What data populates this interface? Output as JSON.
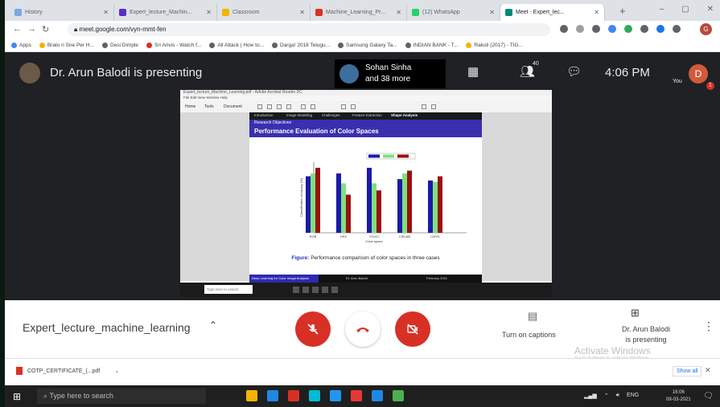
{
  "browser": {
    "tabs": [
      {
        "label": "History",
        "color": "#7aa7e6",
        "active": false
      },
      {
        "label": "Expert_lecture_Machin...",
        "color": "#5b2ec4",
        "active": false
      },
      {
        "label": "Classroom",
        "color": "#f4b400",
        "active": false
      },
      {
        "label": "Machine_Learning_Pr...",
        "color": "#d93025",
        "active": false
      },
      {
        "label": "(12) WhatsApp",
        "color": "#25d366",
        "active": false
      },
      {
        "label": "Meet - Expert_lec...",
        "color": "#00897b",
        "active": true
      }
    ],
    "url": "meet.google.com/vyn-mmt-fen",
    "bookmarks": [
      {
        "label": "Apps",
        "color": "#4285f4"
      },
      {
        "label": "Brato ri Sne Per H...",
        "color": "#f4b400"
      },
      {
        "label": "Desi Dimple",
        "color": "#5f6368"
      },
      {
        "label": "Sri Arivis - Watch f...",
        "color": "#d93025"
      },
      {
        "label": "All Attack | How to...",
        "color": "#5f6368"
      },
      {
        "label": "Darga! 2018 Telugu...",
        "color": "#5f6368"
      },
      {
        "label": "Samsung Galaxy Ta...",
        "color": "#5f6368"
      },
      {
        "label": "INDIAN BANK - T...",
        "color": "#5f6368"
      },
      {
        "label": "Raksti (2017) - TIG...",
        "color": "#f4b400"
      }
    ],
    "profile_initial": "G"
  },
  "meet": {
    "presenting_text": "Dr. Arun Balodi is presenting",
    "joined_line1": "Sohan Sinha",
    "joined_line2": "and 38 more",
    "participants_count": "40",
    "time": "4:06 PM",
    "you_label": "You",
    "user_initial": "D",
    "notification_count": "1"
  },
  "shared_screen": {
    "window_title": "Expert_lecture_Machine_Learning.pdf - Adobe Acrobat Reader DC",
    "menu": "File  Edit  View  Window  Help",
    "tool_tabs": [
      "Home",
      "Tools",
      "Document"
    ],
    "slide_tabs": [
      "Introduction",
      "Image Modeling",
      "Challenges",
      "Feature Extraction",
      "Shape Analysis"
    ],
    "slide_subtitle": "Research Objectives",
    "slide_title": "Performance Evaluation of Color Spaces",
    "caption_prefix": "Figure:",
    "caption_text": "Performance comparison of color spaces in three cases",
    "footer_left": "Deep Learning for Color Image Analysis",
    "footer_mid": "Dr. Arun Balodi",
    "footer_right": "February 2021",
    "taskbar_search": "Type here to search"
  },
  "chart_data": {
    "type": "bar",
    "categories": [
      "RGB",
      "HSV",
      "YCbCr",
      "CIELAB",
      "CMYK"
    ],
    "series": [
      {
        "values": [
          80,
          82,
          86,
          78,
          77
        ],
        "color": "#1a1aa8"
      },
      {
        "values": [
          82,
          75,
          75,
          82,
          76
        ],
        "color": "#7ee07e"
      },
      {
        "values": [
          86,
          67,
          70,
          84,
          80
        ],
        "color": "#9a1010"
      }
    ],
    "ylim": [
      40,
      90
    ],
    "xlabel": "Color space",
    "ylabel": "Classification accuracy (%)"
  },
  "controls": {
    "meeting_name": "Expert_lecture_machine_learning",
    "captions_label": "Turn on captions",
    "present_line1": "Dr. Arun Balodi",
    "present_line2": "is presenting",
    "activate_title": "Activate Windows",
    "activate_sub": "Go to Settings to activate Windows."
  },
  "downloads": {
    "file": "COTP_CERTIFICATE_(...pdf",
    "show_all": "Show all"
  },
  "taskbar": {
    "search_placeholder": "Type here to search",
    "icons": [
      "#f4b400",
      "#1e88e5",
      "#d93025",
      "#00bcd4",
      "#2196f3",
      "#e53935",
      "#1e88e5",
      "#4caf50"
    ],
    "time": "16:06",
    "date": "08-03-2021",
    "lang": "ENG"
  }
}
